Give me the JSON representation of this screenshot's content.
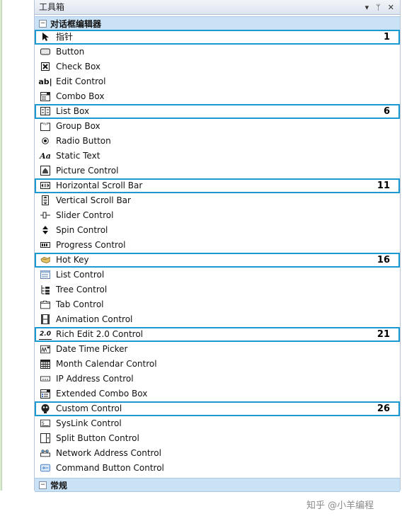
{
  "toolbox": {
    "title": "工具箱",
    "controls": [
      "▾",
      "ᛘ",
      "✕"
    ]
  },
  "group_dialog": {
    "toggle": "⊟",
    "label": "对话框编辑器"
  },
  "items": [
    {
      "label": "指针",
      "icon": "pointer-icon",
      "num": "1"
    },
    {
      "label": "Button",
      "icon": "button-icon",
      "num": ""
    },
    {
      "label": "Check Box",
      "icon": "check-box-icon",
      "num": ""
    },
    {
      "label": "Edit Control",
      "icon": "edit-control-icon",
      "num": ""
    },
    {
      "label": "Combo Box",
      "icon": "combo-box-icon",
      "num": ""
    },
    {
      "label": "List Box",
      "icon": "list-box-icon",
      "num": "6"
    },
    {
      "label": "Group Box",
      "icon": "group-box-icon",
      "num": ""
    },
    {
      "label": "Radio Button",
      "icon": "radio-button-icon",
      "num": ""
    },
    {
      "label": "Static Text",
      "icon": "static-text-icon",
      "num": ""
    },
    {
      "label": "Picture Control",
      "icon": "picture-control-icon",
      "num": ""
    },
    {
      "label": "Horizontal Scroll Bar",
      "icon": "hscroll-icon",
      "num": "11"
    },
    {
      "label": "Vertical Scroll Bar",
      "icon": "vscroll-icon",
      "num": ""
    },
    {
      "label": "Slider Control",
      "icon": "slider-icon",
      "num": ""
    },
    {
      "label": "Spin Control",
      "icon": "spin-icon",
      "num": ""
    },
    {
      "label": "Progress Control",
      "icon": "progress-icon",
      "num": ""
    },
    {
      "label": "Hot Key",
      "icon": "hot-key-icon",
      "num": "16"
    },
    {
      "label": "List Control",
      "icon": "list-control-icon",
      "num": ""
    },
    {
      "label": "Tree Control",
      "icon": "tree-control-icon",
      "num": ""
    },
    {
      "label": "Tab Control",
      "icon": "tab-control-icon",
      "num": ""
    },
    {
      "label": "Animation Control",
      "icon": "animation-icon",
      "num": ""
    },
    {
      "label": "Rich Edit 2.0 Control",
      "icon": "rich-edit-icon",
      "num": "21"
    },
    {
      "label": "Date Time Picker",
      "icon": "date-time-icon",
      "num": ""
    },
    {
      "label": "Month Calendar Control",
      "icon": "calendar-icon",
      "num": ""
    },
    {
      "label": "IP Address Control",
      "icon": "ip-address-icon",
      "num": ""
    },
    {
      "label": "Extended Combo Box",
      "icon": "ext-combo-icon",
      "num": ""
    },
    {
      "label": "Custom Control",
      "icon": "custom-control-icon",
      "num": "26"
    },
    {
      "label": "SysLink Control",
      "icon": "syslink-icon",
      "num": ""
    },
    {
      "label": "Split Button Control",
      "icon": "split-button-icon",
      "num": ""
    },
    {
      "label": "Network Address Control",
      "icon": "network-address-icon",
      "num": ""
    },
    {
      "label": "Command Button Control",
      "icon": "command-button-icon",
      "num": ""
    }
  ],
  "group_general": {
    "toggle": "⊟",
    "label": "常规"
  },
  "watermark": "知乎 @小羊编程",
  "colors": {
    "highlight": "#1a9ad0",
    "group_header": "#c9e2f5"
  }
}
